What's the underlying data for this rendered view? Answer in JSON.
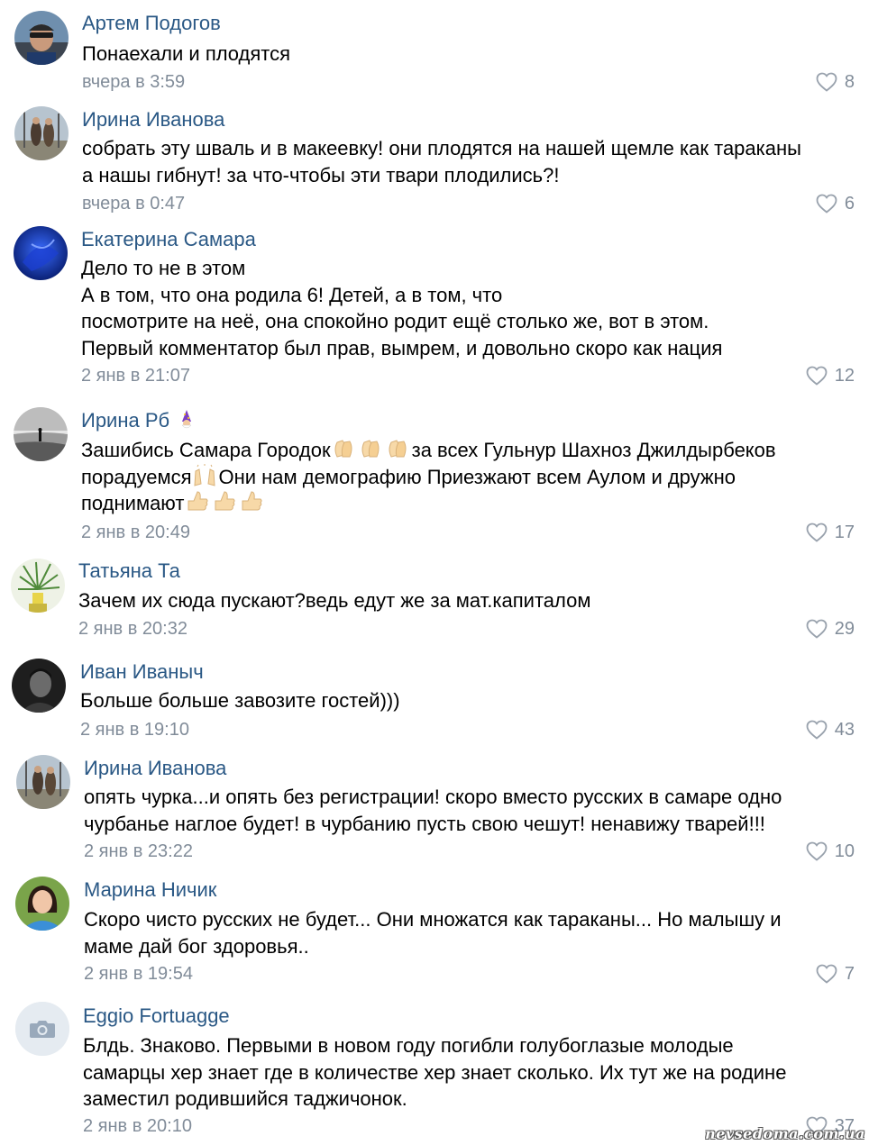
{
  "comments": [
    {
      "author": "Артем Подогов",
      "lines": [
        "Понаехали и плодятся"
      ],
      "date": "вчера в 3:59",
      "likes": "8"
    },
    {
      "author": "Ирина Иванова",
      "lines": [
        "собрать эту шваль и в макеевку! они плодятся на нашей щемле как тараканы",
        "а нашы гибнут! за что-чтобы эти твари плодились?!"
      ],
      "date": "вчера в 0:47",
      "likes": "6"
    },
    {
      "author": "Екатерина Самара",
      "lines": [
        "Дело то не в этом",
        "А в том, что она родила 6! Детей, а в том, что",
        "посмотрите на неё, она спокойно родит ещё столько же, вот в этом.",
        "Первый комментатор был прав, вымрем, и довольно скоро как нация"
      ],
      "date": "2 янв в 21:07",
      "likes": "12"
    },
    {
      "author": "Ирина Рб",
      "author_emoji": "wizard-icon",
      "line1_a": "Зашибись Самара Городок",
      "line1_b": "за всех Гульнур Шахноз Джилдырбеков",
      "line2_a": "порадуемся",
      "line2_b": "Они нам демографию Приезжают всем Аулом и дружно",
      "line3_a": "поднимают",
      "emojis": [
        "clapping-hands-icon",
        "raised-hands-icon",
        "thumbs-up-icon"
      ],
      "date": "2 янв в 20:49",
      "likes": "17"
    },
    {
      "author": "Татьяна Та",
      "lines": [
        "Зачем их сюда пускают?ведь едут же за мат.капиталом"
      ],
      "date": "2 янв в 20:32",
      "likes": "29"
    },
    {
      "author": "Иван Иваныч",
      "lines": [
        "Больше больше завозите гостей)))"
      ],
      "date": "2 янв в 19:10",
      "likes": "43"
    },
    {
      "author": "Ирина Иванова",
      "lines": [
        "опять чурка...и опять без регистрации! скоро вместо русских в самаре одно",
        "чурбанье наглое будет! в чурбанию пусть свою чешут! ненавижу тварей!!!"
      ],
      "date": "2 янв в 23:22",
      "likes": "10"
    },
    {
      "author": "Марина Ничик",
      "lines": [
        "Скоро чисто русских не будет... Они множатся как тараканы... Но малышу и",
        "маме дай бог здоровья.."
      ],
      "date": "2 янв в 19:54",
      "likes": "7"
    },
    {
      "author": "Eggio Fortuagge",
      "lines": [
        "Блдь. Знаково. Первыми в новом году погибли голубоглазые молодые",
        "самарцы хер знает где в количестве хер знает сколько. Их тут же на родине",
        "заместил родившийся таджичонок."
      ],
      "date": "2 янв в 20:10",
      "likes": "37"
    }
  ],
  "watermark": "nevsedoma.com.ua",
  "colors": {
    "author": "#2a5885",
    "meta": "#818c99",
    "text": "#000000"
  },
  "icons": {
    "like": "heart-outline-icon",
    "no_photo": "camera-icon"
  }
}
